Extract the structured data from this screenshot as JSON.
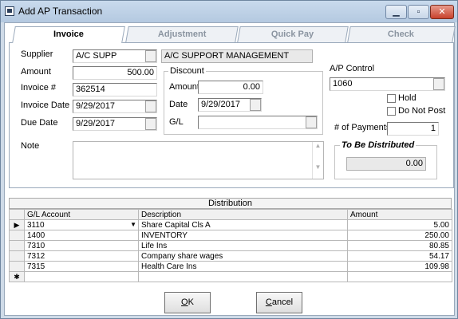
{
  "window": {
    "title": "Add AP Transaction"
  },
  "tabs": [
    {
      "label": "Invoice",
      "active": true
    },
    {
      "label": "Adjustment",
      "active": false
    },
    {
      "label": "Quick Pay",
      "active": false
    },
    {
      "label": "Check",
      "active": false
    }
  ],
  "form": {
    "supplier_label": "Supplier",
    "supplier_code": "A/C SUPP",
    "supplier_name": "A/C SUPPORT MANAGEMENT",
    "amount_label": "Amount",
    "amount_value": "500.00",
    "invoice_label": "Invoice #",
    "invoice_value": "362514",
    "invoice_date_label": "Invoice Date",
    "invoice_date_value": "9/29/2017",
    "due_date_label": "Due Date",
    "due_date_value": "9/29/2017",
    "note_label": "Note",
    "note_value": ""
  },
  "discount": {
    "title": "Discount",
    "amount_label": "Amount",
    "amount_value": "0.00",
    "date_label": "Date",
    "date_value": "9/29/2017",
    "gl_label": "G/L",
    "gl_value": ""
  },
  "ap_control": {
    "label": "A/P Control",
    "value": "1060",
    "hold_label": "Hold",
    "hold_checked": false,
    "do_not_post_label": "Do Not Post",
    "do_not_post_checked": false,
    "payments_label": "# of Payments",
    "payments_value": "1",
    "to_be_distributed_title": "To Be Distributed",
    "to_be_distributed_value": "0.00"
  },
  "distribution": {
    "title": "Distribution",
    "columns": [
      "G/L Account",
      "Description",
      "Amount"
    ],
    "rows": [
      {
        "account": "3110",
        "description": "Share Capital Cls A",
        "amount": "5.00",
        "current": true
      },
      {
        "account": "1400",
        "description": "INVENTORY",
        "amount": "250.00",
        "current": false
      },
      {
        "account": "7310",
        "description": "Life Ins",
        "amount": "80.85",
        "current": false
      },
      {
        "account": "7312",
        "description": "Company share wages",
        "amount": "54.17",
        "current": false
      },
      {
        "account": "7315",
        "description": "Health Care Ins",
        "amount": "109.98",
        "current": false
      }
    ],
    "current_row_marker": "▶",
    "new_row_marker": "✱"
  },
  "buttons": {
    "ok_mnemonic": "O",
    "ok_rest": "K",
    "cancel_mnemonic": "C",
    "cancel_rest": "ancel"
  }
}
